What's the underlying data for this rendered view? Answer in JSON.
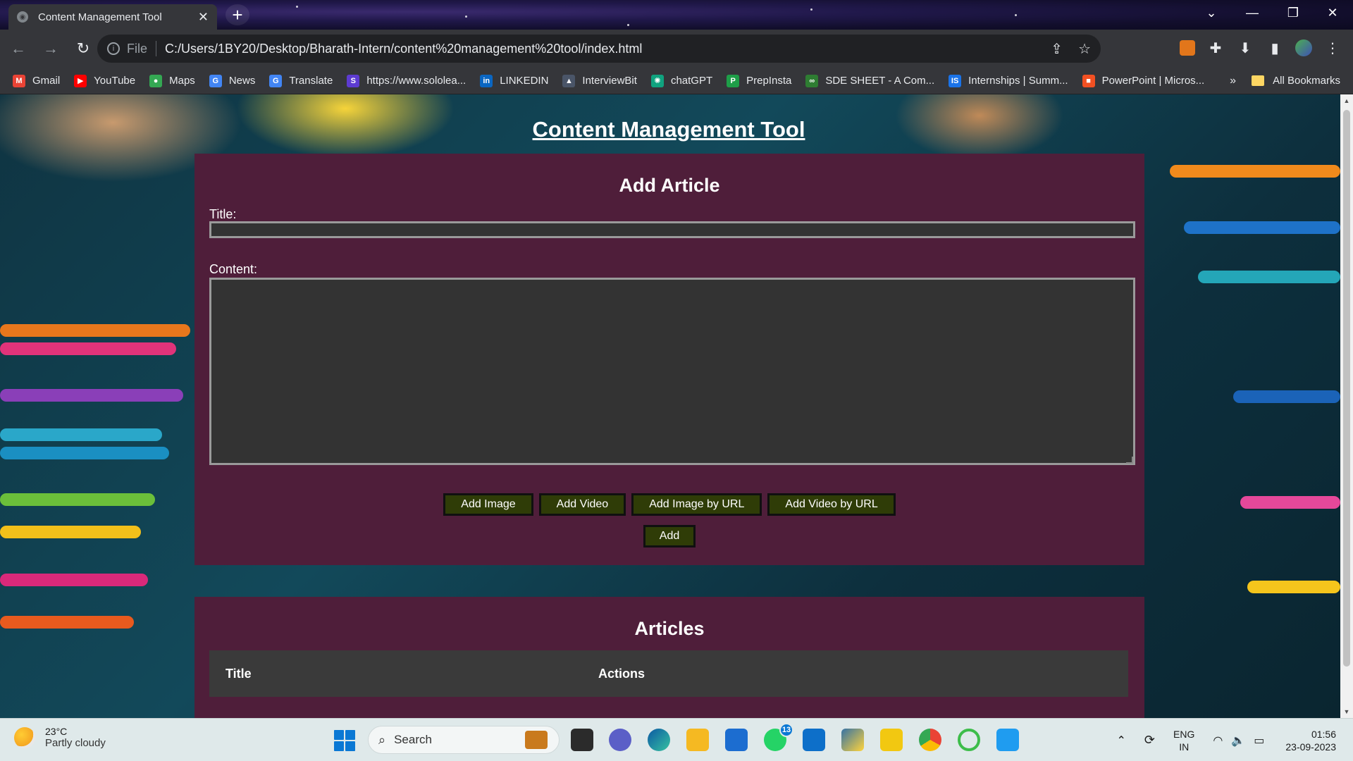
{
  "browser": {
    "tab_title": "Content Management Tool",
    "tab_close": "✕",
    "new_tab": "+",
    "window_controls": {
      "tab_search": "⌄",
      "minimize": "—",
      "restore": "❐",
      "close": "✕"
    },
    "nav": {
      "back": "←",
      "forward": "→",
      "reload": "↻"
    },
    "address": {
      "info": "i",
      "scheme": "File",
      "url": "C:/Users/1BY20/Desktop/Bharath-Intern/content%20management%20tool/index.html",
      "share": "⇪",
      "bookmark": "☆"
    },
    "toolbar_icons": {
      "extensions": "✚",
      "downloads": "⬇",
      "side_panel": "▮",
      "menu": "⋮"
    },
    "bookmarks": [
      {
        "label": "Gmail",
        "icon": "gmail-icon",
        "color": "#ea4335",
        "glyph": "M"
      },
      {
        "label": "YouTube",
        "icon": "youtube-icon",
        "color": "#ff0000",
        "glyph": "▶"
      },
      {
        "label": "Maps",
        "icon": "maps-icon",
        "color": "#34a853",
        "glyph": "●"
      },
      {
        "label": "News",
        "icon": "news-icon",
        "color": "#4285f4",
        "glyph": "G"
      },
      {
        "label": "Translate",
        "icon": "translate-icon",
        "color": "#4285f4",
        "glyph": "G"
      },
      {
        "label": "https://www.sololea...",
        "icon": "sololearn-icon",
        "color": "#5d3bd1",
        "glyph": "S"
      },
      {
        "label": "LINKEDIN",
        "icon": "linkedin-icon",
        "color": "#0a66c2",
        "glyph": "in"
      },
      {
        "label": "InterviewBit",
        "icon": "interviewbit-icon",
        "color": "#4a5568",
        "glyph": "▲"
      },
      {
        "label": "chatGPT",
        "icon": "chatgpt-icon",
        "color": "#10a37f",
        "glyph": "✺"
      },
      {
        "label": "PrepInsta",
        "icon": "prepinsta-icon",
        "color": "#1e9e48",
        "glyph": "P"
      },
      {
        "label": "SDE SHEET - A Com...",
        "icon": "sde-sheet-icon",
        "color": "#2e7d32",
        "glyph": "∞"
      },
      {
        "label": "Internships | Summ...",
        "icon": "internshala-icon",
        "color": "#1a73e8",
        "glyph": "IS"
      },
      {
        "label": "PowerPoint | Micros...",
        "icon": "microsoft-icon",
        "color": "#f25022",
        "glyph": "■"
      }
    ],
    "bookmarks_more": "»",
    "all_bookmarks": "All Bookmarks"
  },
  "page": {
    "heading": "Content Management Tool",
    "add_article": {
      "heading": "Add Article",
      "title_label": "Title:",
      "title_value": "",
      "content_label": "Content:",
      "content_value": "",
      "buttons": {
        "add_image": "Add Image",
        "add_video": "Add Video",
        "add_image_url": "Add Image by URL",
        "add_video_url": "Add Video by URL",
        "add": "Add"
      }
    },
    "articles": {
      "heading": "Articles",
      "columns": [
        "Title",
        "Actions"
      ]
    }
  },
  "taskbar": {
    "weather": {
      "temp": "23°C",
      "condition": "Partly cloudy"
    },
    "search_placeholder": "Search",
    "search_icon": "⌕",
    "whatsapp_badge": "13",
    "tray_chevron": "⌃",
    "tray_sync": "⟳",
    "tray_wifi": "◠",
    "tray_volume": "🔈",
    "tray_battery": "▭",
    "language": {
      "line1": "ENG",
      "line2": "IN"
    },
    "clock": {
      "time": "01:56",
      "date": "23-09-2023"
    }
  },
  "colors": {
    "panel": "#4f1e3a",
    "button": "#2f3c07",
    "table_header": "#3a3a3a",
    "input_bg": "#333333"
  }
}
